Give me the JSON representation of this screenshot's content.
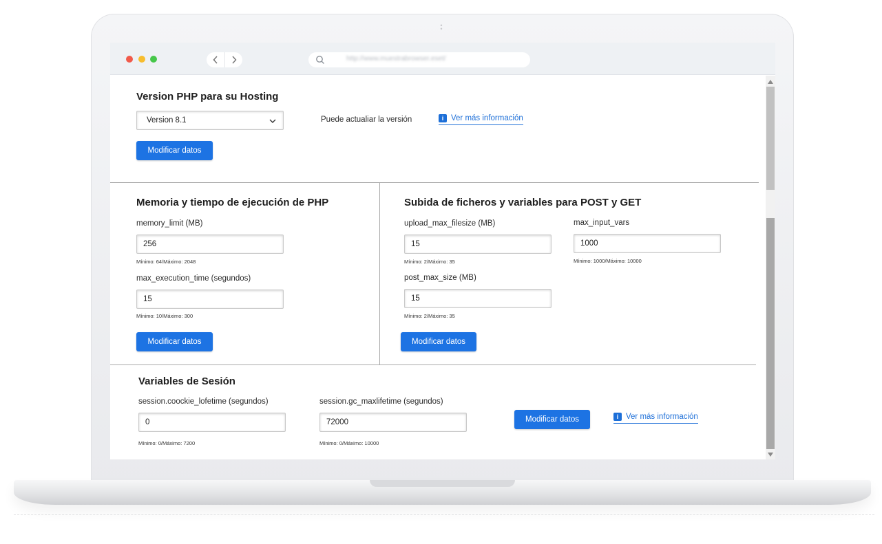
{
  "browser": {
    "url": "http://www.muestrabrowser.eset/"
  },
  "php_version": {
    "title": "Version PHP para su Hosting",
    "select_value": "Version 8.1",
    "note": "Puede actualiar la versión",
    "info_link": "Ver más información",
    "submit": "Modificar datos"
  },
  "memory": {
    "title": "Memoria y tiempo de ejecución de PHP",
    "memory_limit": {
      "label": "memory_limit (MB)",
      "value": "256",
      "hint": "Mínimo: 64/Máximo: 2048"
    },
    "max_execution_time": {
      "label": "max_execution_time (segundos)",
      "value": "15",
      "hint": "Mínimo: 10/Máximo: 300"
    },
    "submit": "Modificar datos"
  },
  "upload": {
    "title": "Subida de ficheros y variables para POST y GET",
    "upload_max_filesize": {
      "label": "upload_max_filesize (MB)",
      "value": "15",
      "hint": "Mínimo: 2/Máximo: 35"
    },
    "max_input_vars": {
      "label": "max_input_vars",
      "value": "1000",
      "hint": "Mínimo: 1000/Máximo: 10000"
    },
    "post_max_size": {
      "label": "post_max_size (MB)",
      "value": "15",
      "hint": "Mínimo: 2/Máximo: 35"
    },
    "submit": "Modificar datos"
  },
  "session": {
    "title": "Variables de Sesión",
    "cookie_lifetime": {
      "label": "session.coockie_lofetime (segundos)",
      "value": "0",
      "hint": "Mínimo: 0/Máximo: 7200"
    },
    "gc_maxlifetime": {
      "label": "session.gc_maxlifetime (segundos)",
      "value": "72000",
      "hint": "Mínimo: 0/Máximo: 10000"
    },
    "submit": "Modificar datos",
    "info_link": "Ver más información"
  },
  "icons": {
    "info": "info-icon",
    "search": "search-icon",
    "chevron": "chevron-down-icon",
    "back": "chevron-left-icon",
    "forward": "chevron-right-icon"
  },
  "colors": {
    "accent": "#1d73e3",
    "link": "#1d6fd8",
    "close_dot": "#f15a4a",
    "minimize_dot": "#f7bd2e",
    "maximize_dot": "#46c74a"
  }
}
